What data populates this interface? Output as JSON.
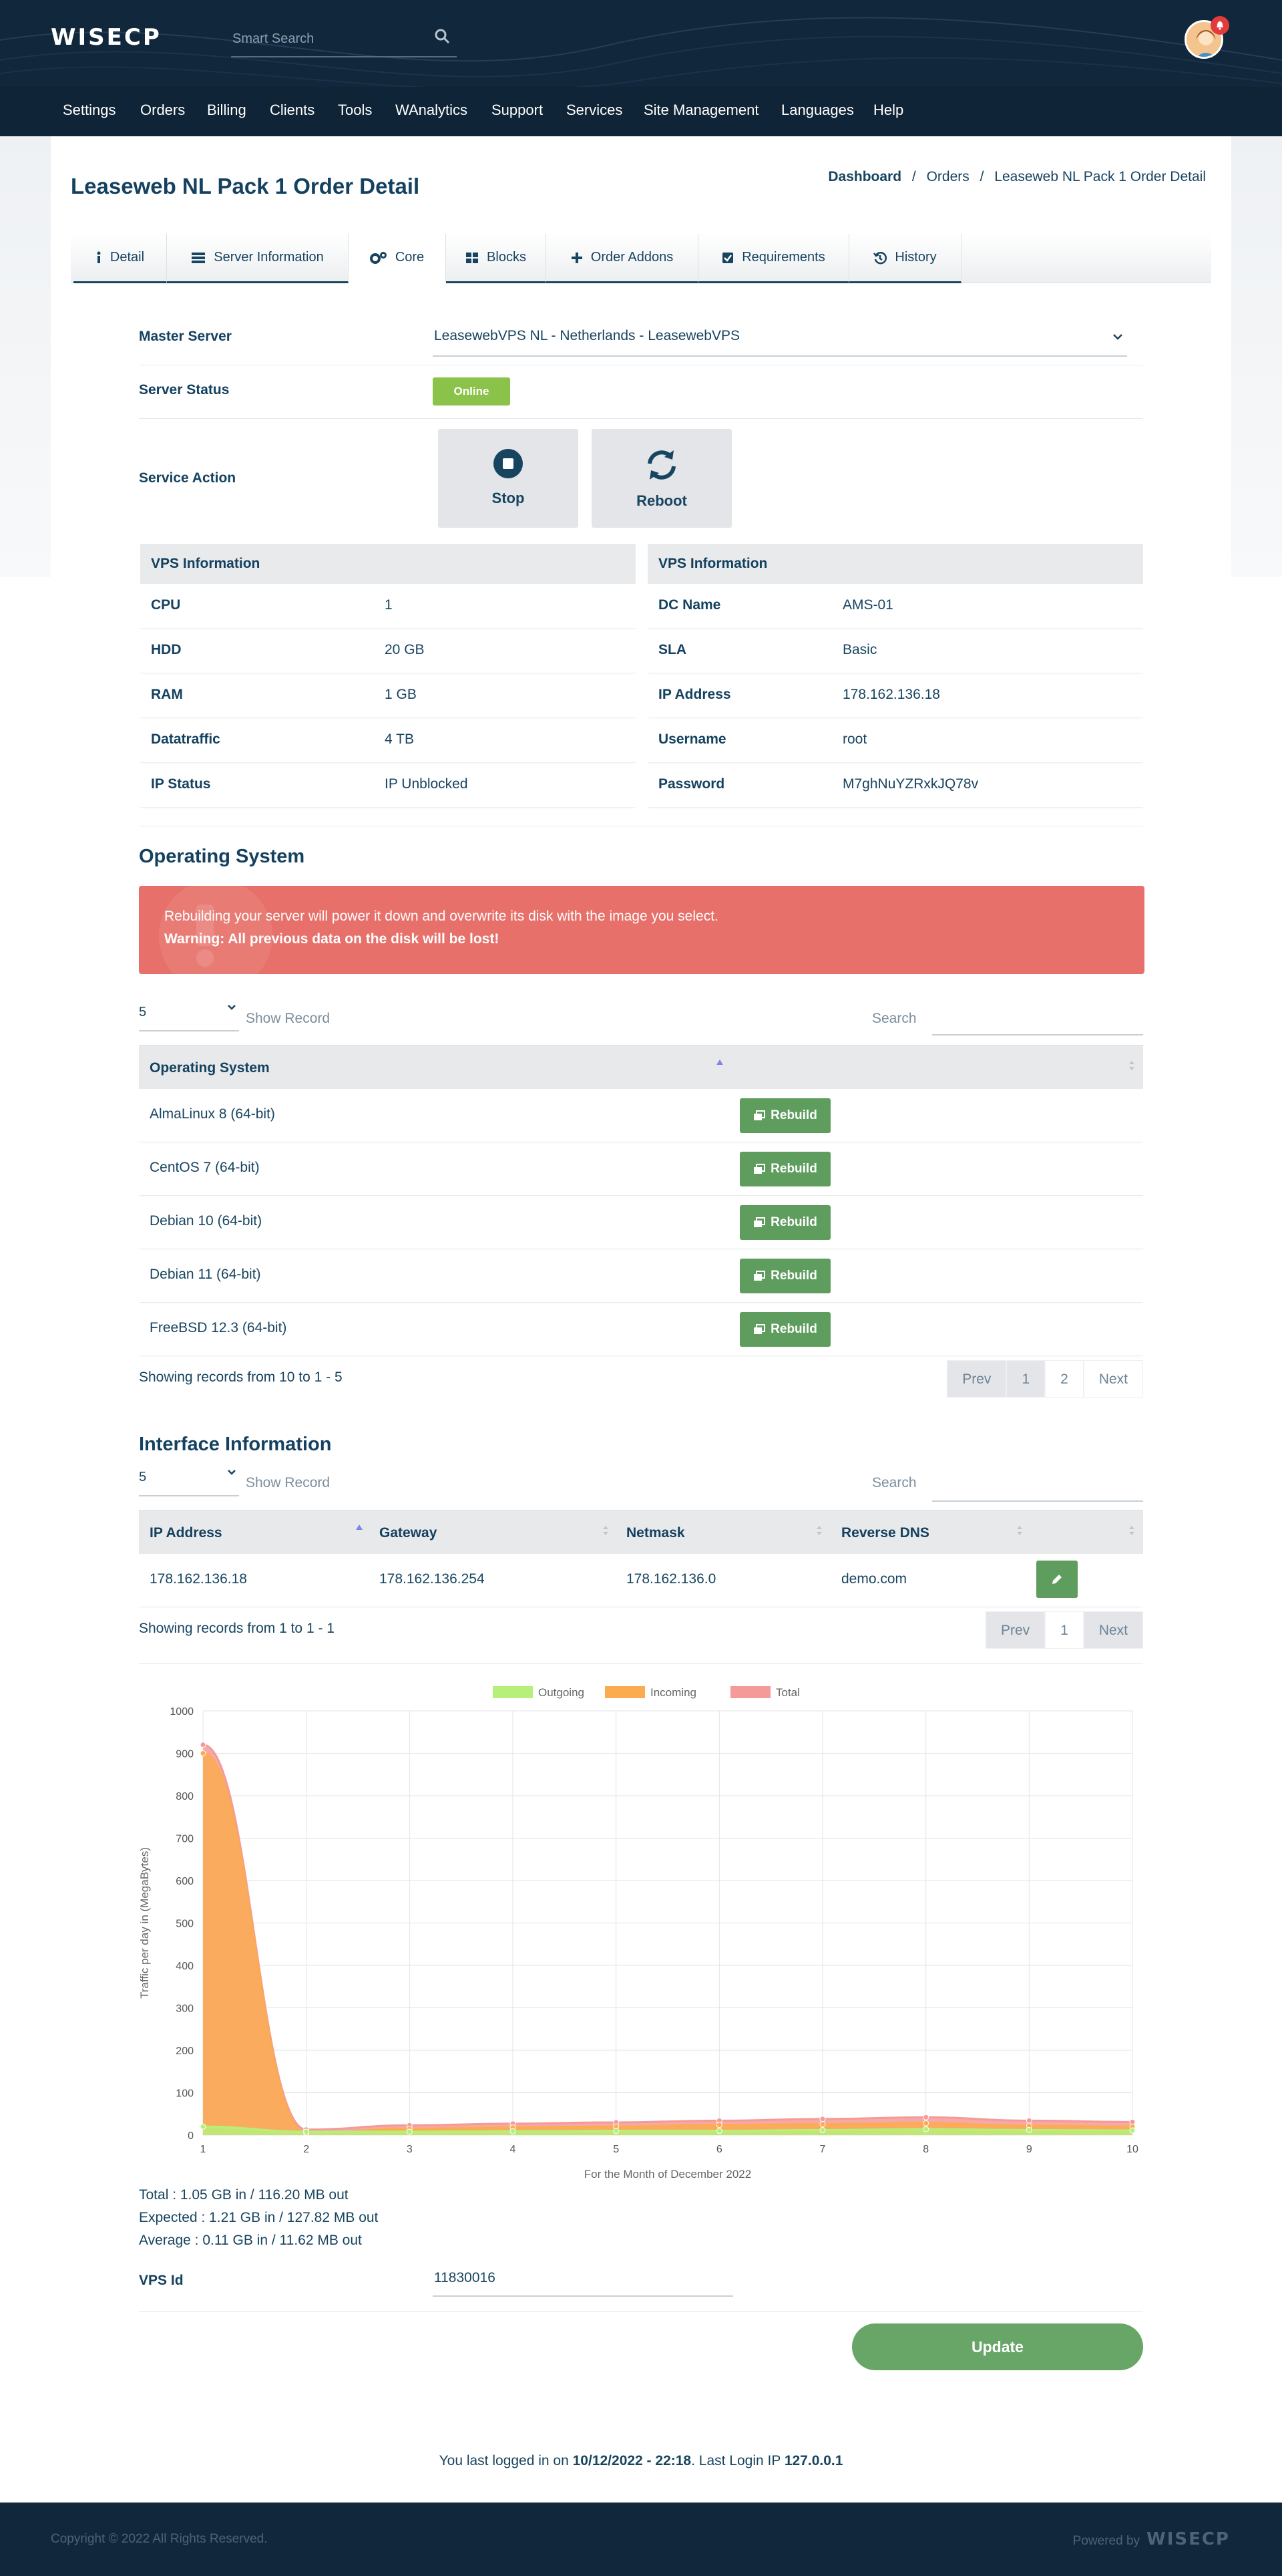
{
  "header": {
    "logo": "WISECP",
    "search_placeholder": "Smart Search",
    "nav": [
      "Settings",
      "Orders",
      "Billing",
      "Clients",
      "Tools",
      "WAnalytics",
      "Support",
      "Services",
      "Site Management",
      "Languages",
      "Help"
    ]
  },
  "page": {
    "title": "Leaseweb NL Pack 1 Order Detail",
    "breadcrumb": [
      "Dashboard",
      "Orders",
      "Leaseweb NL Pack 1 Order Detail"
    ],
    "breadcrumb_sep": "/"
  },
  "tabs": [
    "Detail",
    "Server Information",
    "Core",
    "Blocks",
    "Order Addons",
    "Requirements",
    "History"
  ],
  "core": {
    "master_server_label": "Master Server",
    "master_server_value": "LeasewebVPS NL - Netherlands - LeasewebVPS",
    "server_status_label": "Server Status",
    "server_status_value": "Online",
    "service_action_label": "Service Action",
    "stop_label": "Stop",
    "reboot_label": "Reboot"
  },
  "vps_left": {
    "title": "VPS Information",
    "rows": [
      {
        "k": "CPU",
        "v": "1"
      },
      {
        "k": "HDD",
        "v": "20 GB"
      },
      {
        "k": "RAM",
        "v": "1 GB"
      },
      {
        "k": "Datatraffic",
        "v": "4 TB"
      },
      {
        "k": "IP Status",
        "v": "IP Unblocked"
      }
    ]
  },
  "vps_right": {
    "title": "VPS Information",
    "rows": [
      {
        "k": "DC Name",
        "v": "AMS-01"
      },
      {
        "k": "SLA",
        "v": "Basic"
      },
      {
        "k": "IP Address",
        "v": "178.162.136.18"
      },
      {
        "k": "Username",
        "v": "root"
      },
      {
        "k": "Password",
        "v": "M7ghNuYZRxkJQ78v"
      }
    ]
  },
  "os": {
    "title": "Operating System",
    "alert_line1": "Rebuilding your server will power it down and overwrite its disk with the image you select.",
    "alert_line2": "Warning: All previous data on the disk will be lost!",
    "page_size": "5",
    "show_record": "Show Record",
    "search_label": "Search",
    "column": "Operating System",
    "rebuild_label": "Rebuild",
    "rows": [
      "AlmaLinux 8 (64-bit)",
      "CentOS 7 (64-bit)",
      "Debian 10 (64-bit)",
      "Debian 11 (64-bit)",
      "FreeBSD 12.3 (64-bit)"
    ],
    "showing": "Showing records from 10 to 1 - 5",
    "pager": [
      "Prev",
      "1",
      "2",
      "Next"
    ]
  },
  "iface": {
    "title": "Interface Information",
    "page_size": "5",
    "show_record": "Show Record",
    "search_label": "Search",
    "columns": [
      "IP Address",
      "Gateway",
      "Netmask",
      "Reverse DNS"
    ],
    "row": [
      "178.162.136.18",
      "178.162.136.254",
      "178.162.136.0",
      "demo.com"
    ],
    "showing": "Showing records from 1 to 1 - 1",
    "pager": [
      "Prev",
      "1",
      "Next"
    ]
  },
  "chart_data": {
    "type": "area",
    "x": [
      1,
      2,
      3,
      4,
      5,
      6,
      7,
      8,
      9,
      10
    ],
    "xlabel": "For the Month of December 2022",
    "ylabel": "Traffic per day in (MegaBytes)",
    "ylim": [
      0,
      1000
    ],
    "yticks": [
      0,
      100,
      200,
      300,
      400,
      500,
      600,
      700,
      800,
      900,
      1000
    ],
    "grid": true,
    "legend_position": "top-center",
    "series": [
      {
        "name": "Outgoing",
        "color": "#b6f07a",
        "values": [
          20,
          8,
          8,
          9,
          10,
          10,
          12,
          14,
          12,
          11
        ]
      },
      {
        "name": "Incoming",
        "color": "#fbac50",
        "values": [
          900,
          5,
          15,
          18,
          20,
          24,
          26,
          28,
          22,
          20
        ]
      },
      {
        "name": "Total",
        "color": "#f49a98",
        "values": [
          920,
          13,
          23,
          27,
          30,
          34,
          38,
          42,
          34,
          31
        ]
      }
    ]
  },
  "totals": {
    "total": "Total : 1.05 GB in / 116.20 MB out",
    "expected": "Expected : 1.21 GB in / 127.82 MB out",
    "average": "Average : 0.11 GB in / 11.62 MB out"
  },
  "vps_id": {
    "label": "VPS Id",
    "value": "11830016"
  },
  "update_label": "Update",
  "last_login": {
    "prefix": "You last logged in on ",
    "date": "10/12/2022 - 22:18",
    "mid": ". Last Login IP ",
    "ip": "127.0.0.1"
  },
  "footer": {
    "copyright": "Copyright © 2022 All Rights Reserved.",
    "powered": "Powered by",
    "powered_logo": "WISECP"
  },
  "colors": {
    "navy": "#11273b",
    "online": "#8bc34a",
    "rebuild": "#5e9d5e",
    "alert": "#e8706a",
    "update": "#68a668"
  }
}
